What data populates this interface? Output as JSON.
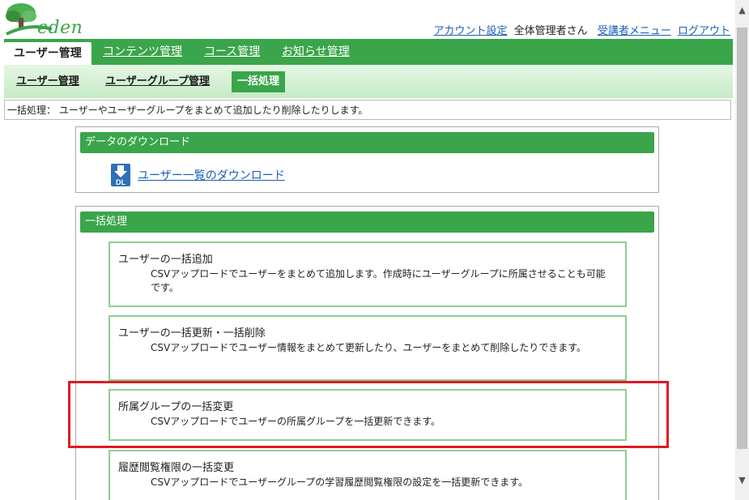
{
  "logo": {
    "text": "eden"
  },
  "toplinks": {
    "account_settings": "アカウント設定",
    "user_name": "全体管理者さん",
    "learner_menu": "受講者メニュー",
    "logout": "ログアウト"
  },
  "main_nav": {
    "tabs": [
      {
        "label": "ユーザー管理",
        "active": true
      },
      {
        "label": "コンテンツ管理"
      },
      {
        "label": "コース管理"
      },
      {
        "label": "お知らせ管理"
      }
    ]
  },
  "sub_nav": {
    "tabs": [
      {
        "label": "ユーザー管理"
      },
      {
        "label": "ユーザーグループ管理"
      },
      {
        "label": "一括処理",
        "active": true
      }
    ]
  },
  "description": "一括処理： ユーザーやユーザーグループをまとめて追加したり削除したりします。",
  "download_section": {
    "title": "データのダウンロード",
    "icon": "download-dl-icon",
    "icon_label": "DL",
    "link": "ユーザー一覧のダウンロード"
  },
  "batch_section": {
    "title": "一括処理",
    "cards": [
      {
        "title": "ユーザーの一括追加",
        "desc": "CSVアップロードでユーザーをまとめて追加します。作成時にユーザーグループに所属させることも可能です。"
      },
      {
        "title": "ユーザーの一括更新・一括削除",
        "desc": "CSVアップロードでユーザー情報をまとめて更新したり、ユーザーをまとめて削除したりできます。"
      },
      {
        "title": "所属グループの一括変更",
        "desc": "CSVアップロードでユーザーの所属グループを一括更新できます。"
      },
      {
        "title": "履歴閲覧権限の一括変更",
        "desc": "CSVアップロードでユーザーグループの学習履歴閲覧権限の設定を一括更新できます。"
      }
    ]
  },
  "colors": {
    "brand_green": "#3aa54a",
    "card_border": "#8fd08f",
    "highlight_red": "#e01b24",
    "link_blue": "#1a5fb4"
  }
}
